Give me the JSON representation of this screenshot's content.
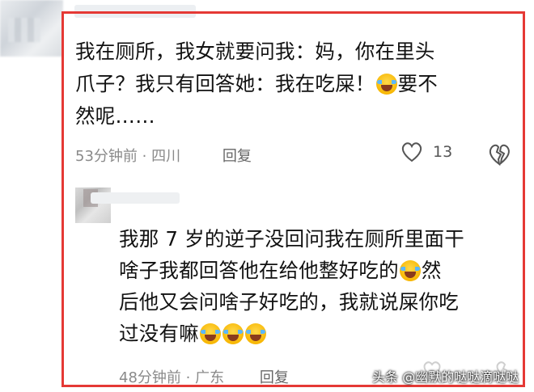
{
  "comment": {
    "text_lines": [
      "我在厕所，我女就要问我：妈，你在里头",
      "爪子？我只有回答她：我在吃屎！",
      "然呢……"
    ],
    "text_after_emoji": "要不",
    "line3_prefix": "",
    "emoji_name": "laughing-crying-emoji",
    "time": "53分钟前",
    "separator": "·",
    "location": "四川",
    "reply_label": "回复",
    "like_count": "13"
  },
  "reply": {
    "text_lines": [
      "我那 7 岁的逆子没回问我在厕所里面干",
      "啥子我都回答他在给他整好吃的",
      "后他又会问啥子好吃的，我就说屎你吃",
      "过没有嘛"
    ],
    "line2_suffix": "然",
    "trailing_emojis": 3,
    "time": "48分钟前",
    "separator": "·",
    "location": "广东",
    "reply_label": "回复"
  },
  "watermark": "头条 @幽默的哒哒滴哒哒",
  "colors": {
    "highlight": "#e53935",
    "meta_text": "#8a8a8a",
    "body_text": "#111111"
  },
  "icons": [
    "heart-outline-icon",
    "dislike-broken-heart-icon",
    "laughing-crying-emoji"
  ]
}
